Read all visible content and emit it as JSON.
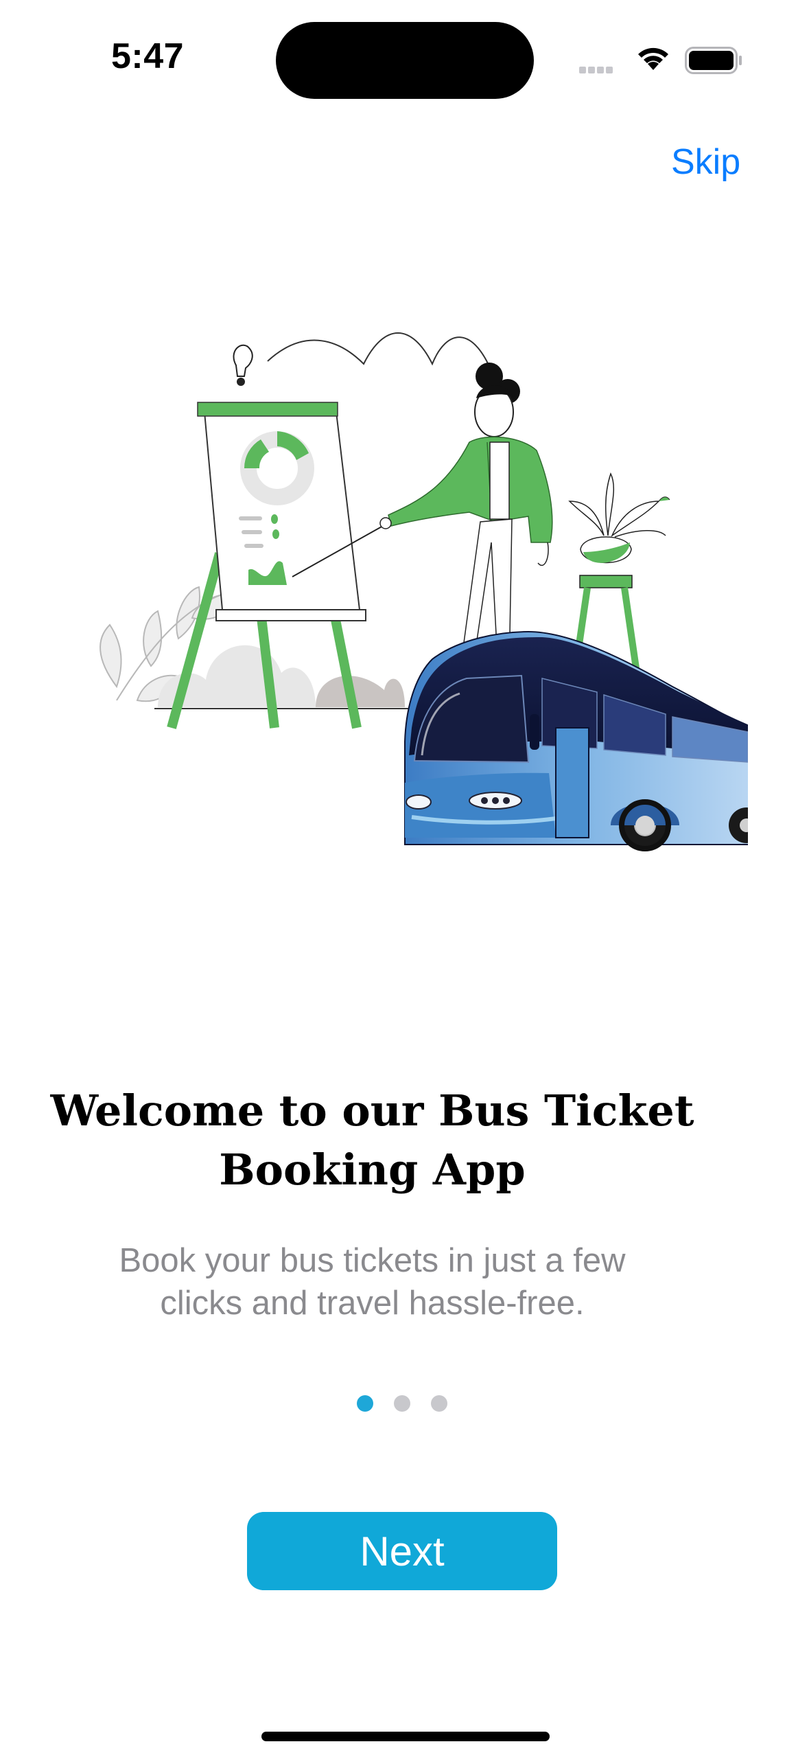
{
  "status_bar": {
    "time": "5:47",
    "icons": [
      "cellular-signal-icon",
      "wifi-icon",
      "battery-icon"
    ]
  },
  "header": {
    "skip_label": "Skip"
  },
  "illustration": {
    "description_icon": "presentation-and-bus-illustration"
  },
  "onboarding": {
    "title": "Welcome to our Bus Ticket Booking App",
    "subtitle": "Book your bus tickets in just a few clicks and travel hassle-free.",
    "total_pages": 3,
    "current_page": 1
  },
  "footer": {
    "next_label": "Next"
  },
  "colors": {
    "accent": "#10a8d8",
    "link": "#0a7dff",
    "illustration_green": "#5cb85c",
    "bus_blue": "#4a8fd0",
    "bus_dark": "#0d1538",
    "subtitle_gray": "#8a8a8e"
  }
}
